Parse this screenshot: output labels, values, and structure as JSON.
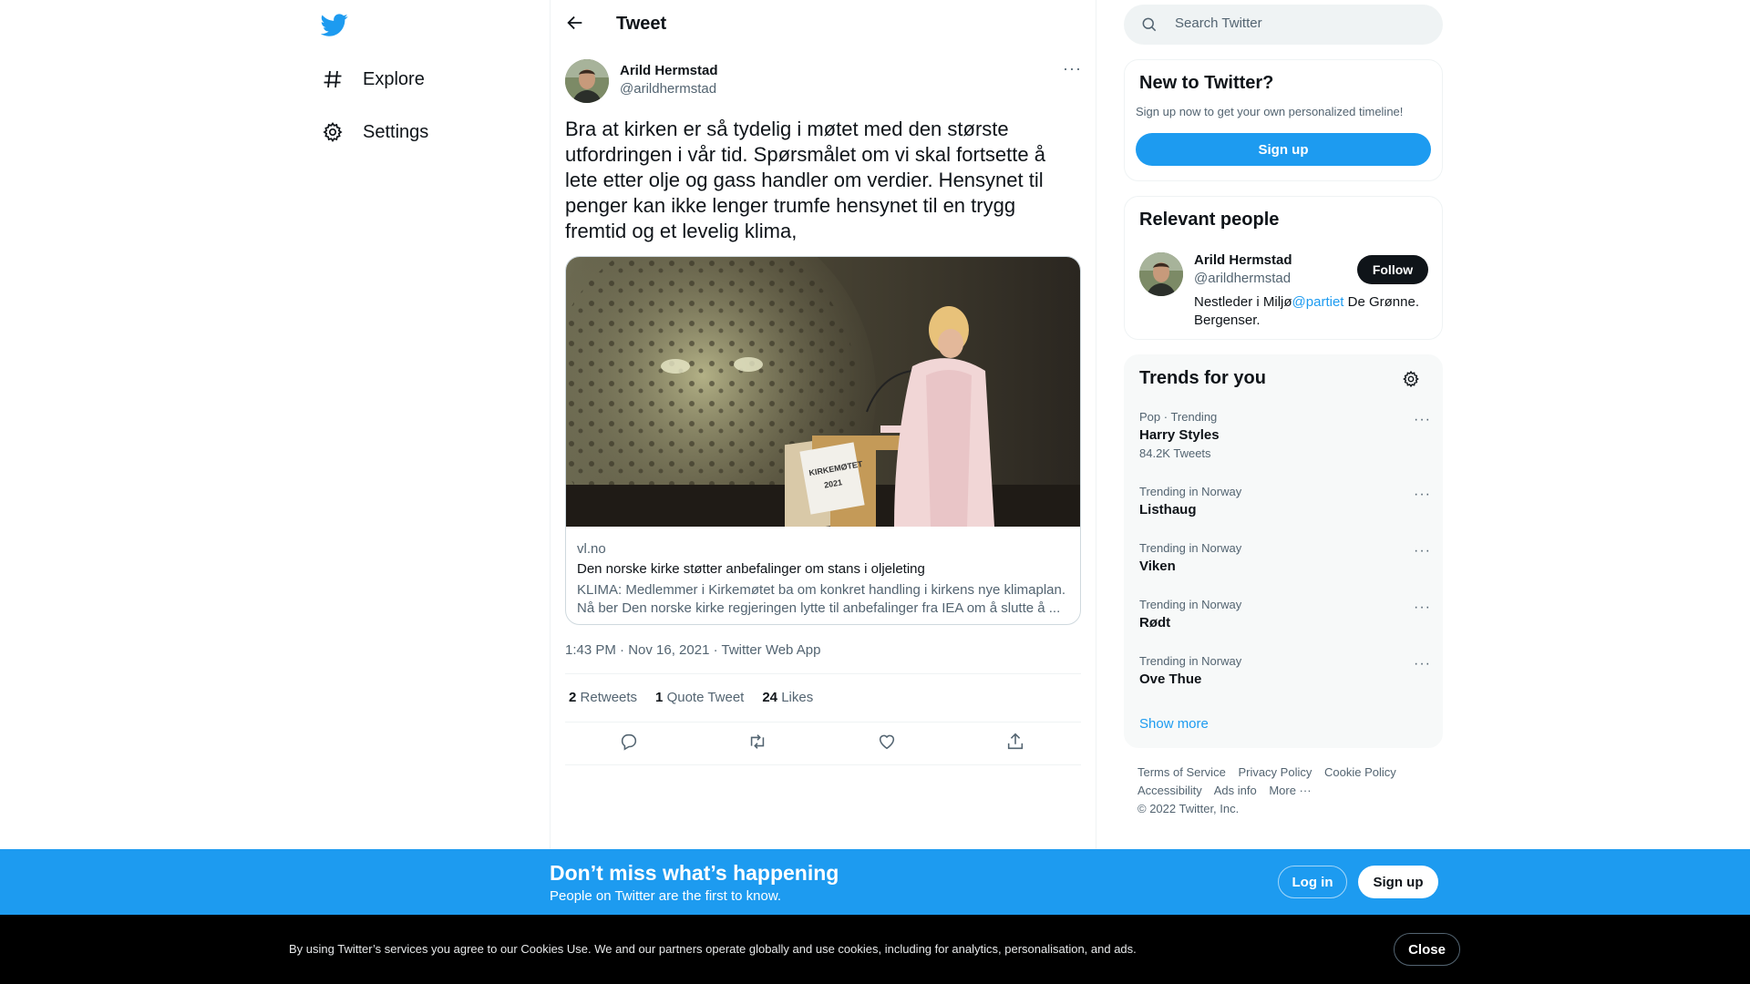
{
  "nav": {
    "logo_icon": "twitter-bird-icon",
    "items": [
      {
        "label": "Explore",
        "icon": "hashtag-icon"
      },
      {
        "label": "Settings",
        "icon": "gear-icon"
      }
    ]
  },
  "header": {
    "title": "Tweet",
    "back_icon": "arrow-left-icon"
  },
  "tweet": {
    "author_name": "Arild Hermstad",
    "author_handle": "@arildhermstad",
    "text": "Bra at kirken er så tydelig i møtet med den største utfordringen i vår tid. Spørsmålet om vi skal fortsette å lete etter olje og gass handler om verdier. Hensynet til penger kan ikke lenger trumfe hensynet til en trygg fremtid og et levelig klima,",
    "card": {
      "domain": "vl.no",
      "title": "Den norske kirke støtter anbefalinger om stans i oljeleting",
      "description": "KLIMA: Medlemmer i Kirkemøtet ba om konkret handling i kirkens nye klimaplan. Nå ber Den norske kirke regjeringen lytte til anbefalinger fra IEA om å slutte å ...",
      "image_sign_line1": "KIRKEMØTET",
      "image_sign_line2": "2021"
    },
    "timestamp": "1:43 PM · Nov 16, 2021 · Twitter Web App",
    "stats": {
      "retweets_count": "2",
      "retweets_label": "Retweets",
      "quotes_count": "1",
      "quotes_label": "Quote Tweet",
      "likes_count": "24",
      "likes_label": "Likes"
    }
  },
  "search": {
    "placeholder": "Search Twitter"
  },
  "new_to_twitter": {
    "title": "New to Twitter?",
    "subtitle": "Sign up now to get your own personalized timeline!",
    "signup_label": "Sign up"
  },
  "relevant_people": {
    "title": "Relevant people",
    "name": "Arild Hermstad",
    "handle": "@arildhermstad",
    "follow_label": "Follow",
    "bio_before": "Nestleder i Miljø",
    "bio_mention": "@partiet",
    "bio_after": " De Grønne. Bergenser."
  },
  "trends": {
    "title": "Trends for you",
    "items": [
      {
        "meta": "Pop · Trending",
        "name": "Harry Styles",
        "count": "84.2K Tweets"
      },
      {
        "meta": "Trending in Norway",
        "name": "Listhaug"
      },
      {
        "meta": "Trending in Norway",
        "name": "Viken"
      },
      {
        "meta": "Trending in Norway",
        "name": "Rødt"
      },
      {
        "meta": "Trending in Norway",
        "name": "Ove Thue"
      }
    ],
    "show_more": "Show more"
  },
  "footer": {
    "links": [
      "Terms of Service",
      "Privacy Policy",
      "Cookie Policy",
      "Accessibility",
      "Ads info",
      "More ···"
    ],
    "copyright": "© 2022 Twitter, Inc."
  },
  "banner": {
    "title": "Don’t miss what’s happening",
    "subtitle": "People on Twitter are the first to know.",
    "login_label": "Log in",
    "signup_label": "Sign up"
  },
  "cookie": {
    "text": "By using Twitter’s services you agree to our Cookies Use. We and our partners operate globally and use cookies, including for analytics, personalisation, and ads.",
    "close_label": "Close"
  },
  "colors": {
    "accent": "#1d9bf0",
    "text": "#0f1419",
    "secondary": "#536471"
  }
}
